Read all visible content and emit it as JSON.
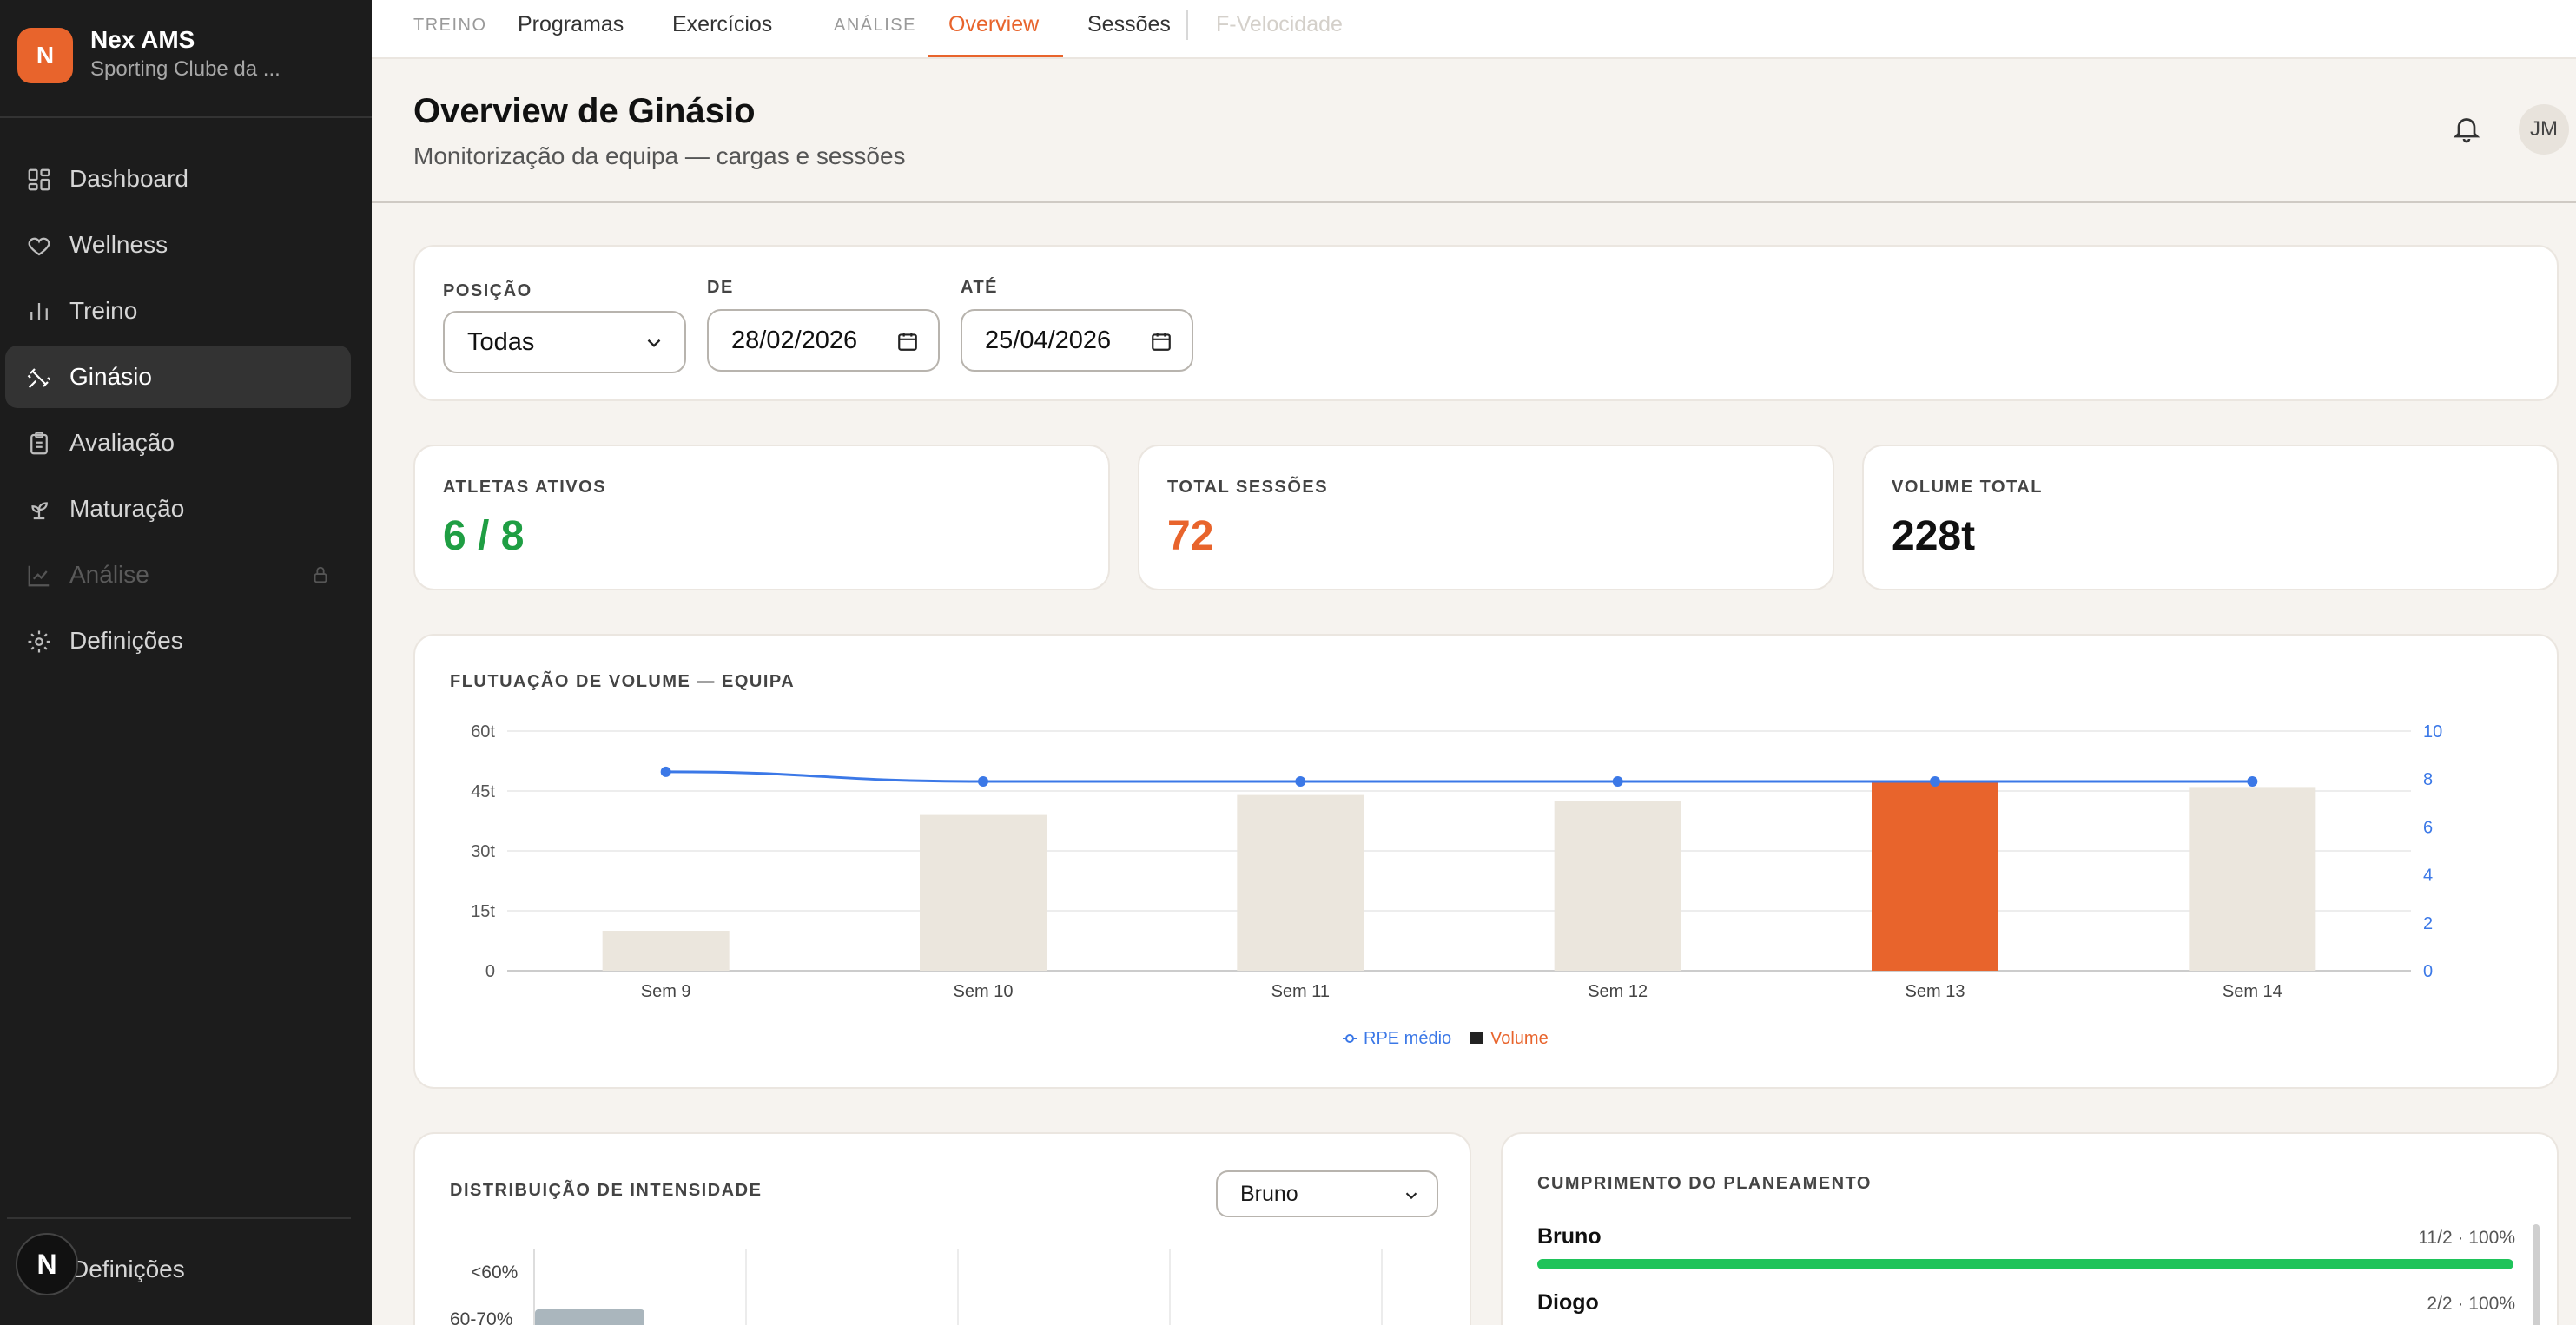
{
  "brand": {
    "logo_letter": "N",
    "name": "Nex AMS",
    "org": "Sporting Clube da ..."
  },
  "sidebar": {
    "items": [
      {
        "label": "Dashboard",
        "icon": "dashboard-icon"
      },
      {
        "label": "Wellness",
        "icon": "heart-icon"
      },
      {
        "label": "Treino",
        "icon": "bar-chart-icon"
      },
      {
        "label": "Ginásio",
        "icon": "dumbbell-icon",
        "active": true
      },
      {
        "label": "Avaliação",
        "icon": "clipboard-icon"
      },
      {
        "label": "Maturação",
        "icon": "sprout-icon"
      },
      {
        "label": "Análise",
        "icon": "line-chart-icon",
        "disabled": true
      },
      {
        "label": "Definições",
        "icon": "gear-icon"
      }
    ],
    "bottom_avatar": "N",
    "bottom_label": "Definições"
  },
  "tabs": {
    "section_treino": "TREINO",
    "programas": "Programas",
    "exercicios": "Exercícios",
    "section_analise": "ANÁLISE",
    "overview": "Overview",
    "sessoes": "Sessões",
    "fvelocidade": "F-Velocidade"
  },
  "header": {
    "title": "Overview de Ginásio",
    "subtitle": "Monitorização da equipa — cargas e sessões",
    "avatar": "JM"
  },
  "filters": {
    "posicao_label": "POSIÇÃO",
    "posicao_value": "Todas",
    "de_label": "DE",
    "de_value": "28/02/2026",
    "ate_label": "ATÉ",
    "ate_value": "25/04/2026"
  },
  "kpis": {
    "atletas_label": "ATLETAS ATIVOS",
    "atletas_value": "6 / 8",
    "sessoes_label": "TOTAL SESSÕES",
    "sessoes_value": "72",
    "volume_label": "VOLUME TOTAL",
    "volume_value": "228t"
  },
  "colors": {
    "accent": "#e8642c",
    "green": "#1f9e43",
    "blue": "#3b78e7",
    "bar": "#ebe6dd"
  },
  "chart_data": {
    "type": "bar",
    "title": "FLUTUAÇÃO DE VOLUME — EQUIPA",
    "categories": [
      "Sem 9",
      "Sem 10",
      "Sem 11",
      "Sem 12",
      "Sem 13",
      "Sem 14"
    ],
    "series": [
      {
        "name": "Volume",
        "type": "bar",
        "axis": "left",
        "values": [
          10,
          39,
          44,
          42.5,
          47.5,
          46
        ],
        "highlight_index": 4
      },
      {
        "name": "RPE médio",
        "type": "line",
        "axis": "right",
        "values": [
          8.3,
          7.9,
          7.9,
          7.9,
          7.9,
          7.9
        ]
      }
    ],
    "y_left": {
      "ticks": [
        "0",
        "15t",
        "30t",
        "45t",
        "60t"
      ],
      "range": [
        0,
        60
      ]
    },
    "y_right": {
      "ticks": [
        "0",
        "2",
        "4",
        "6",
        "8",
        "10"
      ],
      "range": [
        0,
        10
      ]
    },
    "legend": {
      "rpe": "RPE médio",
      "volume": "Volume"
    }
  },
  "intensity": {
    "title": "DISTRIBUIÇÃO DE INTENSIDADE",
    "athlete": "Bruno",
    "rows": [
      "<60%",
      "60-70%"
    ]
  },
  "plan": {
    "title": "CUMPRIMENTO DO PLANEAMENTO",
    "rows": [
      {
        "name": "Bruno",
        "value": "11/2 · 100%"
      },
      {
        "name": "Diogo",
        "value": "2/2 · 100%"
      }
    ]
  }
}
